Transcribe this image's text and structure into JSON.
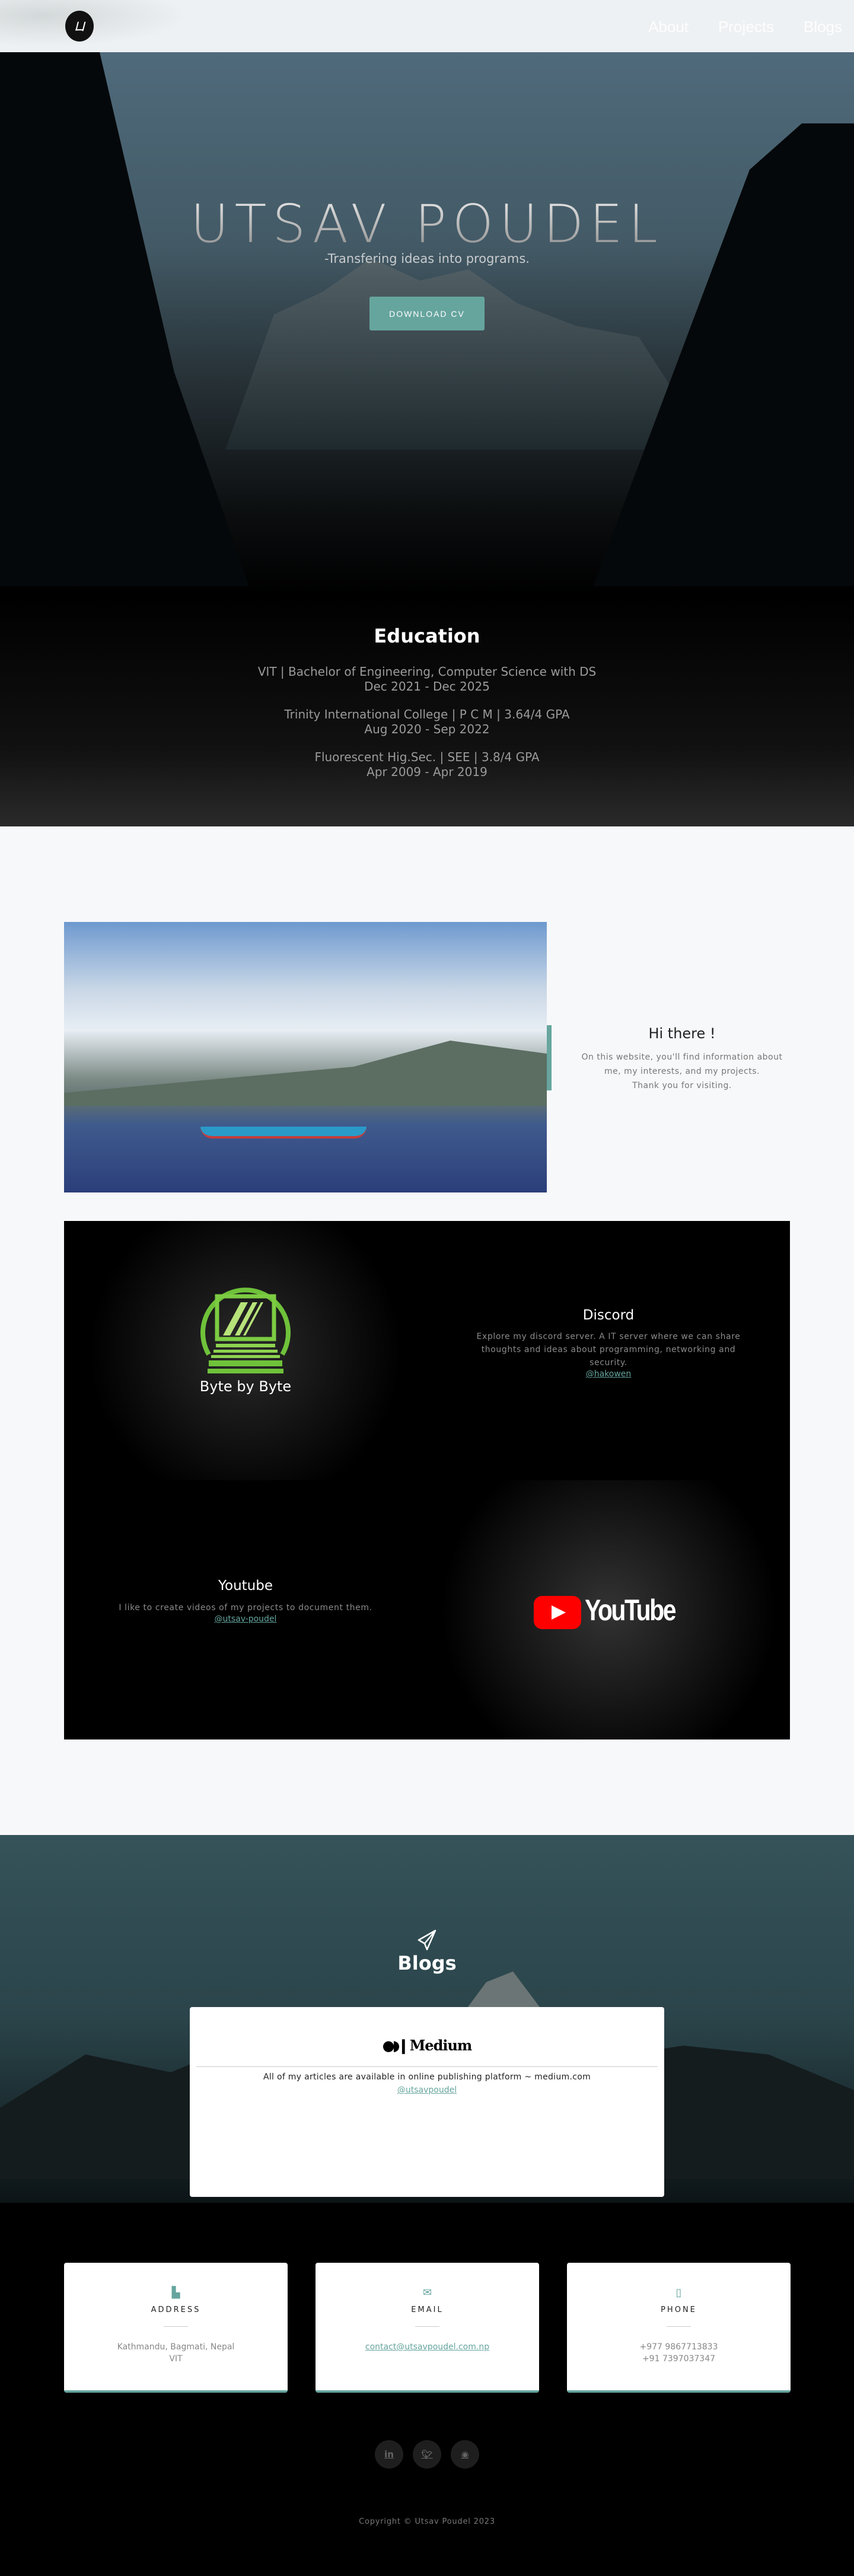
{
  "nav": {
    "logo_text": "UP",
    "links": [
      "About",
      "Projects",
      "Blogs"
    ]
  },
  "hero": {
    "title": "UTSAV POUDEL",
    "subtitle": "-Transfering ideas into programs.",
    "cv_button": "DOWNLOAD CV"
  },
  "education": {
    "heading": "Education",
    "items": [
      {
        "line1": "VIT | Bachelor of Engineering, Computer Science with DS",
        "line2": "Dec 2021 - Dec 2025"
      },
      {
        "line1": "Trinity International College | P C M | 3.64/4 GPA",
        "line2": "Aug 2020 - Sep 2022"
      },
      {
        "line1": "Fluorescent Hig.Sec. | SEE | 3.8/4 GPA",
        "line2": "Apr 2009 - Apr 2019"
      }
    ]
  },
  "about": {
    "heading": "Hi there !",
    "line1": "On this website, you'll find information about",
    "line2": "me, my interests, and my projects.",
    "line3": "Thank you for visiting."
  },
  "projects": {
    "byte_logo": "Byte by Byte",
    "discord": {
      "title": "Discord",
      "desc": "Explore my discord server. A IT server where we can share thoughts and ideas about programming, networking and security.",
      "link": "@hakowen"
    },
    "youtube": {
      "title": "Youtube",
      "desc": "I like to create videos of my projects to document them.",
      "link": "@utsav-poudel",
      "logo": "YouTube"
    }
  },
  "blogs": {
    "heading": "Blogs",
    "icon": "paper-plane-icon",
    "logo": "Medium",
    "desc": "All of my articles are available in online publishing platform ~ medium.com",
    "link": "@utsavpoudel"
  },
  "contact": [
    {
      "label": "ADDRESS",
      "icon": "map-icon",
      "values": [
        "Kathmandu, Bagmati, Nepal",
        "VIT"
      ]
    },
    {
      "label": "EMAIL",
      "icon": "envelope-icon",
      "values": [
        "contact@utsavpoudel.com.np"
      ]
    },
    {
      "label": "PHONE",
      "icon": "mobile-icon",
      "values": [
        "+977 9867713833",
        "+91 7397037347"
      ]
    }
  ],
  "social": [
    "linkedin-icon",
    "twitter-icon",
    "github-icon"
  ],
  "footer": {
    "copyright": "Copyright © Utsav Poudel 2023"
  },
  "colors": {
    "accent": "#66a59e"
  }
}
